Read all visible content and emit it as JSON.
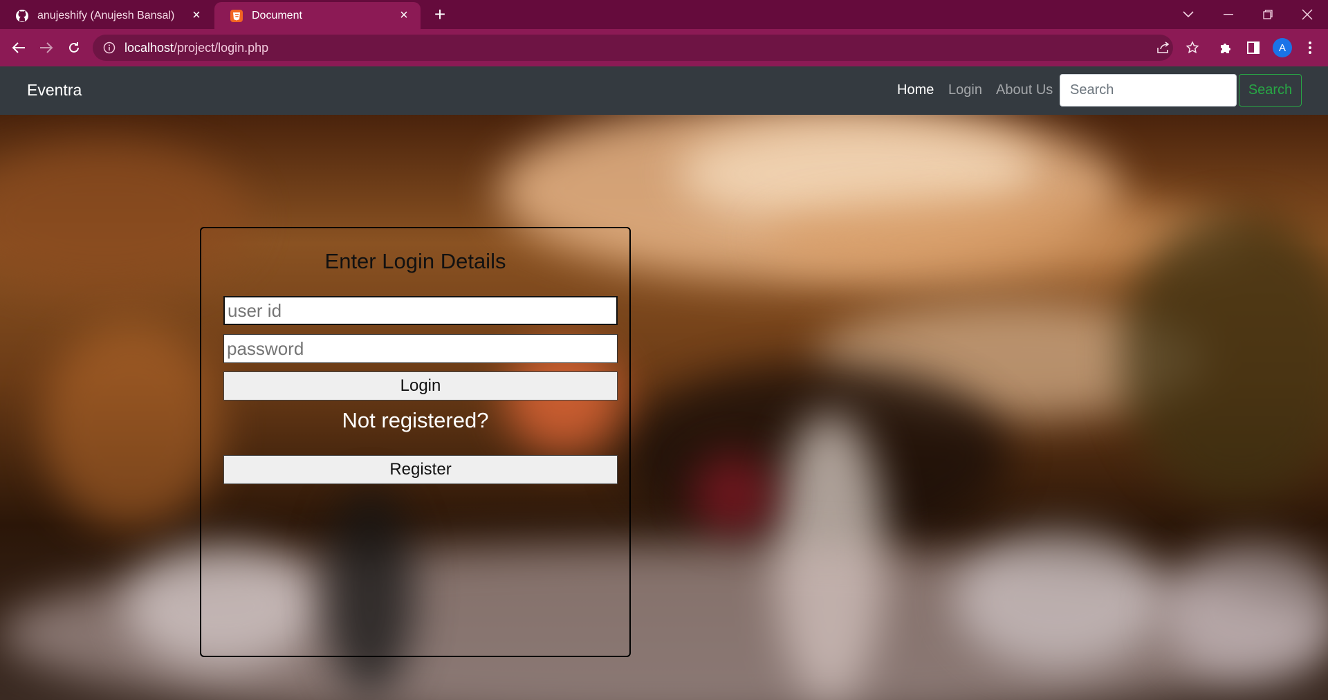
{
  "browser": {
    "tabs": [
      {
        "title": "anujeshify (Anujesh Bansal)",
        "favicon": "github-icon",
        "active": false
      },
      {
        "title": "Document",
        "favicon": "html5-icon",
        "active": true
      }
    ],
    "url_host": "localhost",
    "url_path": "/project/login.php",
    "profile_initial": "A"
  },
  "navbar": {
    "brand": "Eventra",
    "links": [
      {
        "label": "Home",
        "active": true
      },
      {
        "label": "Login",
        "active": false
      },
      {
        "label": "About Us",
        "active": false
      }
    ],
    "search_placeholder": "Search",
    "search_button": "Search"
  },
  "login": {
    "heading": "Enter Login Details",
    "userid_placeholder": "user id",
    "password_placeholder": "password",
    "login_button": "Login",
    "not_registered": "Not registered?",
    "register_button": "Register"
  },
  "colors": {
    "tabstrip": "#650b3c",
    "toolbar": "#8c1a55",
    "navbar": "#343a40",
    "search_accent": "#28a745"
  }
}
